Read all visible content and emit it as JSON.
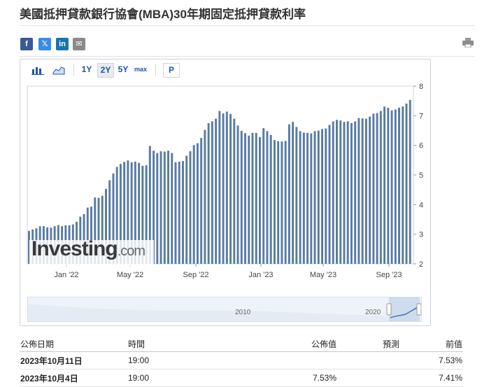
{
  "title": "美國抵押貸款銀行協會(MBA)30年期固定抵押貸款利率",
  "share": {
    "fb": "f",
    "twitter": "𝕏",
    "linkedin": "in",
    "email": "✉"
  },
  "toolbar": {
    "r1": "1Y",
    "r2": "2Y",
    "r5": "5Y",
    "rmax": "max",
    "p": "P"
  },
  "watermark": {
    "brand": "Investing",
    "suffix": ".com"
  },
  "navigator": {
    "labels": [
      "2010",
      "2020"
    ]
  },
  "colors": {
    "bar": "#587ba1",
    "accent": "#1c56a8"
  },
  "chart_data": {
    "type": "bar",
    "ylim": [
      2,
      8
    ],
    "yticks": [
      "2",
      "3",
      "4",
      "5",
      "6",
      "7",
      "8"
    ],
    "xtick_labels": [
      "Jan '22",
      "May '22",
      "Sep '22",
      "Jan '23",
      "May '23",
      "Sep '23"
    ],
    "values": [
      3.11,
      3.16,
      3.2,
      3.27,
      3.27,
      3.23,
      3.22,
      3.27,
      3.31,
      3.27,
      3.3,
      3.3,
      3.33,
      3.42,
      3.59,
      3.68,
      3.9,
      3.93,
      4.24,
      4.23,
      4.3,
      4.53,
      4.82,
      5.05,
      5.27,
      5.37,
      5.44,
      5.49,
      5.43,
      5.45,
      5.41,
      5.31,
      5.33,
      5.98,
      5.82,
      5.74,
      5.8,
      5.79,
      5.82,
      5.74,
      5.43,
      5.45,
      5.47,
      5.65,
      5.8,
      6.01,
      6.07,
      6.25,
      6.52,
      6.75,
      6.81,
      6.9,
      7.16,
      7.08,
      7.14,
      7.06,
      6.9,
      6.67,
      6.49,
      6.41,
      6.33,
      6.42,
      6.42,
      6.28,
      6.58,
      6.48,
      6.35,
      6.18,
      6.14,
      6.13,
      6.15,
      6.71,
      6.79,
      6.62,
      6.48,
      6.43,
      6.42,
      6.4,
      6.48,
      6.5,
      6.55,
      6.57,
      6.69,
      6.81,
      6.86,
      6.84,
      6.79,
      6.81,
      6.75,
      6.81,
      6.92,
      6.91,
      6.9,
      6.97,
      7.07,
      7.09,
      7.16,
      7.31,
      7.27,
      7.18,
      7.21,
      7.27,
      7.31,
      7.41,
      7.53
    ]
  },
  "table": {
    "headers": {
      "date": "公佈日期",
      "time": "時間",
      "actual": "公佈值",
      "forecast": "預測",
      "previous": "前值"
    },
    "rows": [
      {
        "date": "2023年10月11日",
        "time": "19:00",
        "actual": "",
        "forecast": "",
        "previous": "7.53%"
      },
      {
        "date": "2023年10月4日",
        "time": "19:00",
        "actual": "7.53%",
        "forecast": "",
        "previous": "7.41%"
      }
    ]
  }
}
